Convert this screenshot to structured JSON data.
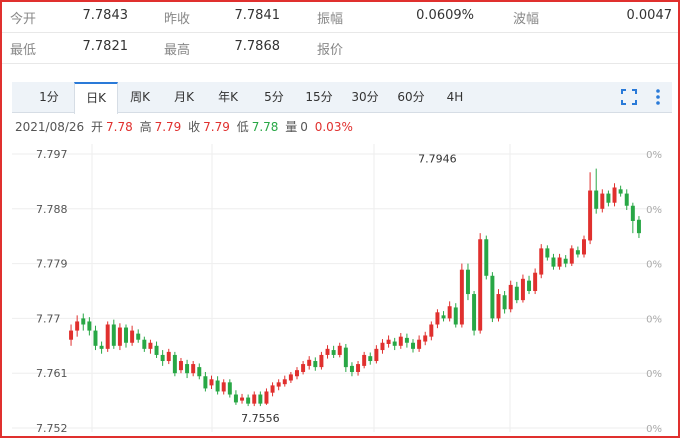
{
  "quote": {
    "row1": [
      {
        "label": "今开",
        "value": "7.7843"
      },
      {
        "label": "昨收",
        "value": "7.7841"
      },
      {
        "label": "振幅",
        "value": "0.0609%"
      },
      {
        "label": "波幅",
        "value": "0.0047"
      }
    ],
    "row2": [
      {
        "label": "最低",
        "value": "7.7821"
      },
      {
        "label": "最高",
        "value": "7.7868"
      },
      {
        "label": "报价",
        "value": ""
      }
    ]
  },
  "tabs": [
    "1分",
    "日K",
    "周K",
    "月K",
    "年K",
    "5分",
    "15分",
    "30分",
    "60分",
    "4H"
  ],
  "active_tab": "日K",
  "icons": {
    "fullscreen": "fullscreen-icon",
    "more": "more-vert-icon"
  },
  "info": {
    "date": "2021/08/26",
    "open_label": "开",
    "open": "7.78",
    "high_label": "高",
    "high": "7.79",
    "close_label": "收",
    "close": "7.79",
    "low_label": "低",
    "low": "7.78",
    "vol_label": "量",
    "vol": "0",
    "change": "0.03%"
  },
  "colors": {
    "up": "#e0302e",
    "down": "#28a745",
    "accent": "#2a7ad8",
    "frame": "#e0302e"
  },
  "chart_data": {
    "type": "candlestick",
    "y_ticks": [
      "7.797",
      "7.788",
      "7.779",
      "7.77",
      "7.761",
      "7.752"
    ],
    "y_tick_values": [
      7.797,
      7.788,
      7.779,
      7.77,
      7.761,
      7.752
    ],
    "right_ticks": [
      "0%",
      "0%",
      "0%",
      "0%",
      "0%",
      "0%"
    ],
    "ylim": [
      7.752,
      7.797
    ],
    "grid": true,
    "annotations": [
      {
        "label": "7.7946",
        "index": 60,
        "value": 7.7946
      },
      {
        "label": "7.7556",
        "index": 31,
        "value": 7.7556
      }
    ],
    "candles": [
      [
        7.7665,
        7.768,
        7.769,
        7.7655
      ],
      [
        7.768,
        7.7695,
        7.7705,
        7.767
      ],
      [
        7.77,
        7.769,
        7.7708,
        7.768
      ],
      [
        7.7695,
        7.768,
        7.7702,
        7.7672
      ],
      [
        7.768,
        7.7655,
        7.7688,
        7.7648
      ],
      [
        7.7655,
        7.765,
        7.7662,
        7.7642
      ],
      [
        7.765,
        7.769,
        7.7695,
        7.7645
      ],
      [
        7.769,
        7.7655,
        7.7698,
        7.765
      ],
      [
        7.7655,
        7.7685,
        7.7692,
        7.7648
      ],
      [
        7.7685,
        7.766,
        7.769,
        7.7652
      ],
      [
        7.766,
        7.768,
        7.7688,
        7.7655
      ],
      [
        7.7675,
        7.7665,
        7.7682,
        7.766
      ],
      [
        7.7665,
        7.765,
        7.767,
        7.7645
      ],
      [
        7.765,
        7.766,
        7.7665,
        7.7642
      ],
      [
        7.7655,
        7.764,
        7.7662,
        7.7635
      ],
      [
        7.764,
        7.763,
        7.7648,
        7.7622
      ],
      [
        7.763,
        7.7645,
        7.765,
        7.7625
      ],
      [
        7.764,
        7.761,
        7.7645,
        7.7605
      ],
      [
        7.7615,
        7.763,
        7.7635,
        7.761
      ],
      [
        7.7625,
        7.761,
        7.7632,
        7.7602
      ],
      [
        7.761,
        7.7625,
        7.763,
        7.7605
      ],
      [
        7.762,
        7.7605,
        7.7626,
        7.76
      ],
      [
        7.7605,
        7.7585,
        7.7612,
        7.758
      ],
      [
        7.759,
        7.76,
        7.7606,
        7.7584
      ],
      [
        7.7598,
        7.758,
        7.7605,
        7.7575
      ],
      [
        7.758,
        7.7595,
        7.76,
        7.7575
      ],
      [
        7.7595,
        7.7575,
        7.76,
        7.757
      ],
      [
        7.7575,
        7.7562,
        7.7582,
        7.7558
      ],
      [
        7.7565,
        7.757,
        7.7576,
        7.756
      ],
      [
        7.757,
        7.756,
        7.7575,
        7.7556
      ],
      [
        7.756,
        7.7575,
        7.758,
        7.7556
      ],
      [
        7.7575,
        7.756,
        7.758,
        7.7556
      ],
      [
        7.756,
        7.758,
        7.7585,
        7.7558
      ],
      [
        7.7578,
        7.759,
        7.7595,
        7.7572
      ],
      [
        7.7588,
        7.7595,
        7.76,
        7.7582
      ],
      [
        7.7592,
        7.76,
        7.7606,
        7.7588
      ],
      [
        7.7598,
        7.7608,
        7.7612,
        7.7594
      ],
      [
        7.7605,
        7.7615,
        7.762,
        7.76
      ],
      [
        7.7612,
        7.7625,
        7.763,
        7.7608
      ],
      [
        7.7622,
        7.7632,
        7.7638,
        7.7616
      ],
      [
        7.763,
        7.762,
        7.7636,
        7.7614
      ],
      [
        7.762,
        7.764,
        7.7645,
        7.7616
      ],
      [
        7.764,
        7.765,
        7.7656,
        7.7634
      ],
      [
        7.7648,
        7.764,
        7.7655,
        7.7635
      ],
      [
        7.764,
        7.7655,
        7.766,
        7.7636
      ],
      [
        7.7652,
        7.762,
        7.7658,
        7.7612
      ],
      [
        7.7622,
        7.7612,
        7.7628,
        7.7605
      ],
      [
        7.7612,
        7.7625,
        7.763,
        7.7606
      ],
      [
        7.7622,
        7.764,
        7.7645,
        7.7618
      ],
      [
        7.7638,
        7.763,
        7.7644,
        7.7624
      ],
      [
        7.763,
        7.765,
        7.7656,
        7.7626
      ],
      [
        7.7648,
        7.766,
        7.7666,
        7.7642
      ],
      [
        7.7658,
        7.7665,
        7.7672,
        7.7652
      ],
      [
        7.7662,
        7.7655,
        7.7668,
        7.7648
      ],
      [
        7.7655,
        7.767,
        7.7676,
        7.765
      ],
      [
        7.7668,
        7.766,
        7.7675,
        7.7652
      ],
      [
        7.766,
        7.765,
        7.7666,
        7.7644
      ],
      [
        7.765,
        7.7665,
        7.7672,
        7.7645
      ],
      [
        7.7662,
        7.7672,
        7.7678,
        7.7656
      ],
      [
        7.767,
        7.769,
        7.7695,
        7.7664
      ],
      [
        7.769,
        7.771,
        7.7715,
        7.7684
      ],
      [
        7.7705,
        7.77,
        7.7712,
        7.7695
      ],
      [
        7.77,
        7.772,
        7.7728,
        7.7695
      ],
      [
        7.7718,
        7.769,
        7.7725,
        7.7685
      ],
      [
        7.769,
        7.778,
        7.779,
        7.7685
      ],
      [
        7.778,
        7.774,
        7.779,
        7.773
      ],
      [
        7.774,
        7.768,
        7.7745,
        7.7672
      ],
      [
        7.768,
        7.783,
        7.784,
        7.7675
      ],
      [
        7.783,
        7.777,
        7.7836,
        7.7764
      ],
      [
        7.777,
        7.77,
        7.7776,
        7.7694
      ],
      [
        7.77,
        7.774,
        7.7748,
        7.7695
      ],
      [
        7.7738,
        7.7715,
        7.7745,
        7.7708
      ],
      [
        7.7715,
        7.7755,
        7.7762,
        7.771
      ],
      [
        7.7752,
        7.773,
        7.776,
        7.7725
      ],
      [
        7.773,
        7.7765,
        7.7772,
        7.7726
      ],
      [
        7.7762,
        7.7745,
        7.777,
        7.774
      ],
      [
        7.7745,
        7.7775,
        7.7782,
        7.774
      ],
      [
        7.7772,
        7.7815,
        7.7822,
        7.7766
      ],
      [
        7.7815,
        7.78,
        7.782,
        7.7795
      ],
      [
        7.78,
        7.7785,
        7.7806,
        7.778
      ],
      [
        7.7785,
        7.78,
        7.7806,
        7.778
      ],
      [
        7.7798,
        7.779,
        7.7804,
        7.7784
      ],
      [
        7.779,
        7.7815,
        7.782,
        7.7786
      ],
      [
        7.7812,
        7.7805,
        7.7818,
        7.78
      ],
      [
        7.7805,
        7.783,
        7.7836,
        7.78
      ],
      [
        7.7828,
        7.791,
        7.794,
        7.7822
      ],
      [
        7.791,
        7.788,
        7.7946,
        7.7872
      ],
      [
        7.788,
        7.7905,
        7.7912,
        7.7874
      ],
      [
        7.7905,
        7.789,
        7.791,
        7.7884
      ],
      [
        7.789,
        7.7915,
        7.7922,
        7.7884
      ],
      [
        7.7912,
        7.7905,
        7.7918,
        7.79
      ],
      [
        7.7905,
        7.7885,
        7.7912,
        7.7878
      ],
      [
        7.7885,
        7.786,
        7.789,
        7.784
      ],
      [
        7.7862,
        7.784,
        7.7868,
        7.7832
      ]
    ]
  }
}
